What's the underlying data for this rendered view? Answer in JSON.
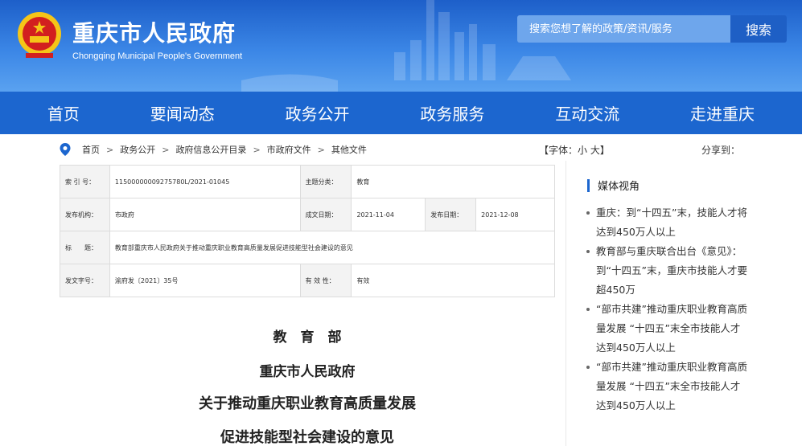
{
  "header": {
    "title": "重庆市人民政府",
    "subtitle": "Chongqing Municipal People's Government",
    "search_placeholder": "搜索您想了解的政策/资讯/服务",
    "search_button": "搜索"
  },
  "nav": [
    "首页",
    "要闻动态",
    "政务公开",
    "政务服务",
    "互动交流",
    "走进重庆"
  ],
  "breadcrumb": [
    "首页",
    "政务公开",
    "政府信息公开目录",
    "市政府文件",
    "其他文件"
  ],
  "font_control": "【字体：小 大】",
  "share_label": "分享到：",
  "info": {
    "index_label": "索 引 号：",
    "index_value": "11500000009275780L/2021-01045",
    "category_label": "主题分类：",
    "category_value": "教育",
    "issuer_label": "发布机构：",
    "issuer_value": "市政府",
    "written_label": "成文日期：",
    "written_value": "2021-11-04",
    "published_label": "发布日期：",
    "published_value": "2021-12-08",
    "title_label": "标　　题：",
    "title_value": "教育部重庆市人民政府关于推动重庆职业教育高质量发展促进技能型社会建设的意见",
    "docno_label": "发文字号：",
    "docno_value": "渝府发〔2021〕35号",
    "valid_label": "有 效 性：",
    "valid_value": "有效"
  },
  "document": {
    "line1": "教　育　部",
    "line2": "重庆市人民政府",
    "line3": "关于推动重庆职业教育高质量发展",
    "line4": "促进技能型社会建设的意见"
  },
  "sidebar": {
    "heading": "媒体视角",
    "items": [
      "重庆：到“十四五”末，技能人才将达到450万人以上",
      "教育部与重庆联合出台《意见》：到“十四五”末，重庆市技能人才要超450万",
      "“部市共建”推动重庆职业教育高质量发展 “十四五”末全市技能人才达到450万人以上",
      "“部市共建”推动重庆职业教育高质量发展 “十四五”末全市技能人才达到450万人以上"
    ]
  },
  "icons": {
    "emblem": "national-emblem-icon",
    "location": "location-pin-icon"
  },
  "colors": {
    "header_blue": "#2f78dd",
    "nav_blue": "#1c66cf",
    "search_button": "#1e5fc5"
  }
}
